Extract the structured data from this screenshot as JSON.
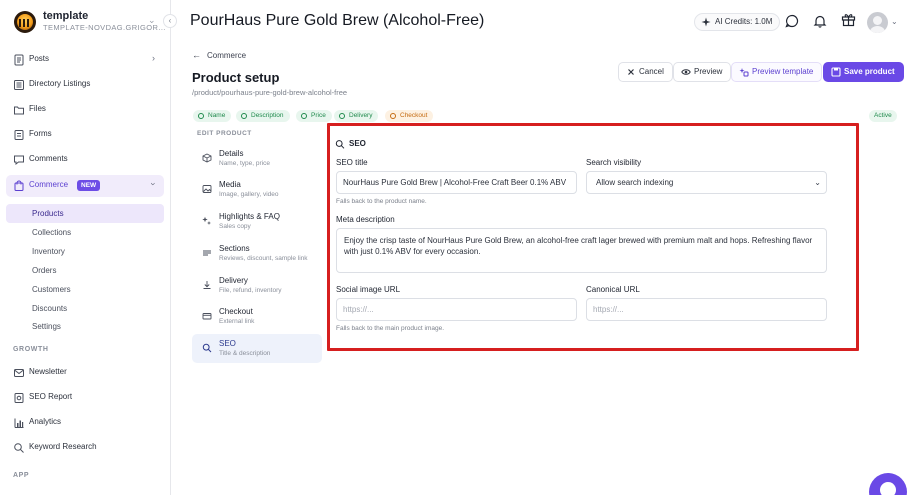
{
  "app": {
    "workspace_name": "template",
    "workspace_id": "TEMPLATE-NOVDAG.GRIGOR..."
  },
  "sidebar": {
    "items": [
      {
        "label": "Posts"
      },
      {
        "label": "Directory Listings"
      },
      {
        "label": "Files"
      },
      {
        "label": "Forms"
      },
      {
        "label": "Comments"
      },
      {
        "label": "Commerce",
        "badge": "NEW"
      }
    ],
    "commerce_sub": [
      {
        "label": "Products"
      },
      {
        "label": "Collections"
      },
      {
        "label": "Inventory"
      },
      {
        "label": "Orders"
      },
      {
        "label": "Customers"
      },
      {
        "label": "Discounts"
      },
      {
        "label": "Settings"
      }
    ],
    "growth_heading": "GROWTH",
    "growth_items": [
      {
        "label": "Newsletter"
      },
      {
        "label": "SEO Report"
      },
      {
        "label": "Analytics"
      },
      {
        "label": "Keyword Research"
      }
    ],
    "app_heading": "APP"
  },
  "header": {
    "title": "PourHaus Pure Gold Brew (Alcohol-Free)",
    "credits": "AI Credits: 1.0M"
  },
  "main": {
    "back_label": "Commerce",
    "setup_title": "Product setup",
    "path": "/product/pourhaus-pure-gold-brew-alcohol-free",
    "actions": {
      "cancel": "Cancel",
      "preview": "Preview",
      "preview_template": "Preview template",
      "save": "Save product"
    },
    "steps": [
      {
        "label": "Name",
        "state": "done"
      },
      {
        "label": "Description",
        "state": "done"
      },
      {
        "label": "Price",
        "state": "done"
      },
      {
        "label": "Delivery",
        "state": "done"
      },
      {
        "label": "Checkout",
        "state": "pending"
      }
    ],
    "status": "Active",
    "edit_heading": "EDIT PRODUCT",
    "tabs": [
      {
        "label": "Details",
        "sub": "Name, type, price"
      },
      {
        "label": "Media",
        "sub": "Image, gallery, video"
      },
      {
        "label": "Highlights & FAQ",
        "sub": "Sales copy"
      },
      {
        "label": "Sections",
        "sub": "Reviews, discount, sample link"
      },
      {
        "label": "Delivery",
        "sub": "File, refund, inventory"
      },
      {
        "label": "Checkout",
        "sub": "External link"
      },
      {
        "label": "SEO",
        "sub": "Title & description"
      }
    ]
  },
  "seo": {
    "heading": "SEO",
    "title_label": "SEO title",
    "title_value": "NourHaus Pure Gold Brew | Alcohol-Free Craft Beer 0.1% ABV",
    "title_hint": "Falls back to the product name.",
    "visibility_label": "Search visibility",
    "visibility_value": "Allow search indexing",
    "meta_label": "Meta description",
    "meta_value": "Enjoy the crisp taste of NourHaus Pure Gold Brew, an alcohol-free craft lager brewed with premium malt and hops. Refreshing flavor with just 0.1% ABV for every occasion.",
    "social_label": "Social image URL",
    "social_placeholder": "https://...",
    "social_hint": "Falls back to the main product image.",
    "canonical_label": "Canonical URL",
    "canonical_placeholder": "https://..."
  },
  "colors": {
    "accent": "#6a49e6",
    "highlight_border": "#d61f1f",
    "success": "#1f8a4c",
    "warning": "#c46a10"
  }
}
